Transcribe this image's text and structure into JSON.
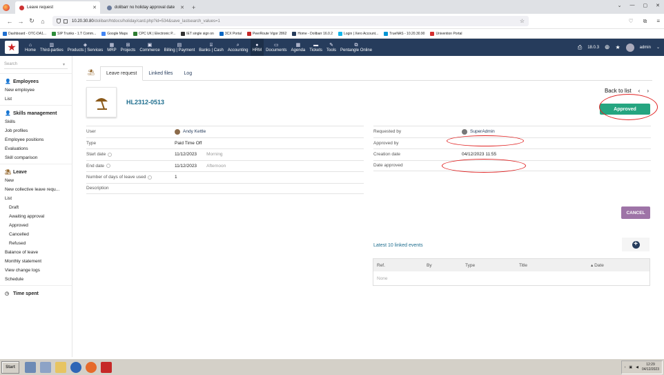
{
  "browser": {
    "tabs": [
      {
        "label": "Leave request",
        "active": true
      },
      {
        "label": "dolibarr no holiday approval date",
        "active": false
      }
    ],
    "url_host": "10.20.30.80",
    "url_path": "/dolibarr/htdocs/holiday/card.php?id=534&save_lastsearch_values=1",
    "bookmarks": [
      "Dashboard - OTC-DA1...",
      "SIP Trunks - 1.T Comm...",
      "Google Maps",
      "CPC UK | Electronic P...",
      "IET single sign on",
      "3CX Portal",
      "PeerRoute Vigor 2862",
      "Home - Dolibarr 16.0.2",
      "Login | Xero Account...",
      "TrueNAS - 10.20.30.90",
      "Univention Portal"
    ]
  },
  "topmenu": {
    "items": [
      {
        "label": "Home",
        "icon": "home-icon"
      },
      {
        "label": "Third-parties",
        "icon": "building-icon"
      },
      {
        "label": "Products | Services",
        "icon": "cube-icon"
      },
      {
        "label": "MRP",
        "icon": "cubes-icon"
      },
      {
        "label": "Projects",
        "icon": "sitemap-icon"
      },
      {
        "label": "Commerce",
        "icon": "suitcase-icon"
      },
      {
        "label": "Billing | Payment",
        "icon": "money-icon"
      },
      {
        "label": "Banks | Cash",
        "icon": "bank-icon"
      },
      {
        "label": "Accounting",
        "icon": "search-dollar-icon"
      },
      {
        "label": "HRM",
        "icon": "user-tie-icon",
        "selected": true
      },
      {
        "label": "Documents",
        "icon": "folder-icon"
      },
      {
        "label": "Agenda",
        "icon": "calendar-icon"
      },
      {
        "label": "Tickets",
        "icon": "ticket-icon"
      },
      {
        "label": "Tools",
        "icon": "wrench-icon"
      },
      {
        "label": "Pentangle Online",
        "icon": "external-icon"
      }
    ],
    "version": "18.0.3",
    "user": "admin"
  },
  "sidebar": {
    "search_placeholder": "Search",
    "employees_title": "Employees",
    "employees_links": [
      "New employee",
      "List"
    ],
    "skills_title": "Skills management",
    "skills_links": [
      "Skills",
      "Job profiles",
      "Employee positions",
      "Evaluations",
      "Skill comparison"
    ],
    "leave_title": "Leave",
    "leave_links": [
      "New",
      "New collective leave requ...",
      "List"
    ],
    "leave_sublinks": [
      "Draft",
      "Awaiting approval",
      "Approved",
      "Cancelled",
      "Refused"
    ],
    "leave_links2": [
      "Balance of leave",
      "Monthly statement",
      "View change logs",
      "Schedule"
    ],
    "time_title": "Time spent"
  },
  "card": {
    "tabs": [
      "Leave request",
      "Linked files",
      "Log"
    ],
    "ref": "HL2312-0513",
    "back_to_list": "Back to list",
    "status": "Approved",
    "left": {
      "user_label": "User",
      "user_value": "Andy Kettle",
      "type_label": "Type",
      "type_value": "Paid Time Off",
      "start_label": "Start date",
      "start_value": "11/12/2023",
      "start_half": "Morning",
      "end_label": "End date",
      "end_value": "11/12/2023",
      "end_half": "Afternoon",
      "days_label": "Number of days of leave used",
      "days_value": "1",
      "desc_label": "Description",
      "desc_value": ""
    },
    "right": {
      "requested_label": "Requested by",
      "requested_value": "SuperAdmin",
      "approved_label": "Approved by",
      "approved_value": "",
      "creation_label": "Creation date",
      "creation_value": "04/12/2023 11:55",
      "date_approved_label": "Date approved",
      "date_approved_value": ""
    },
    "cancel_button": "CANCEL",
    "events_title": "Latest 10 linked events",
    "events_columns": [
      "Ref.",
      "By",
      "Type",
      "Title",
      "Date"
    ],
    "events_empty": "None"
  },
  "taskbar": {
    "start": "Start",
    "time": "12:29",
    "date": "04/12/2023"
  },
  "colors": {
    "topmenu_bg": "#263c5c",
    "status_approved": "#25a580",
    "cancel_button": "#9e74a7",
    "annotation": "#e02020"
  }
}
